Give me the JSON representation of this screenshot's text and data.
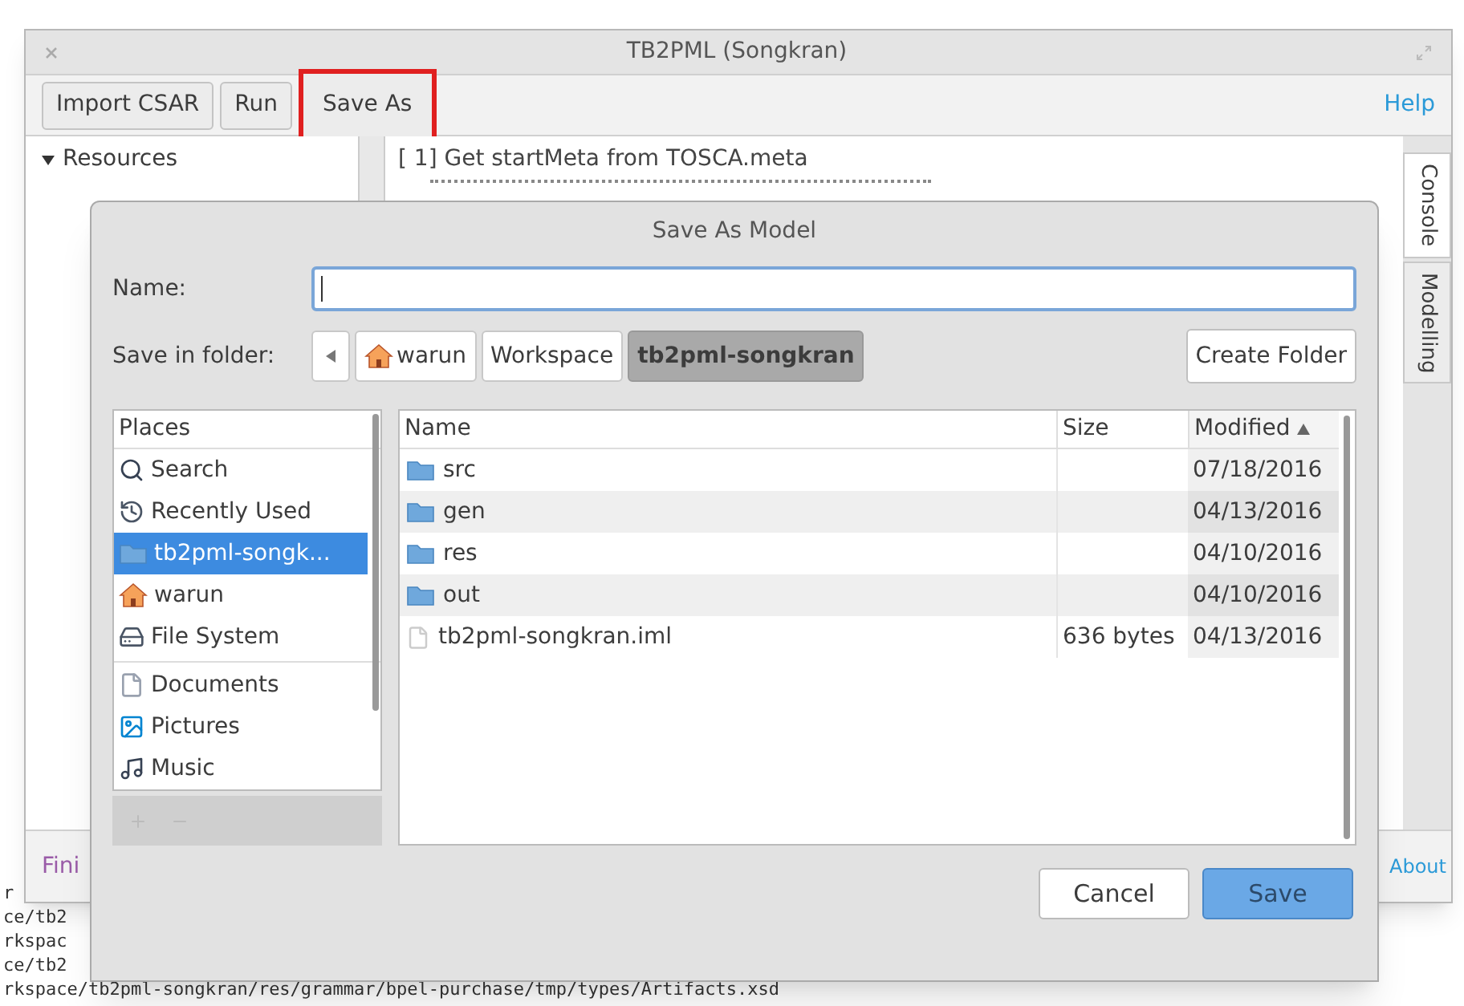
{
  "main_window": {
    "title": "TB2PML (Songkran)",
    "toolbar": [
      {
        "label": "Import CSAR",
        "highlighted": false
      },
      {
        "label": "Run",
        "highlighted": false
      },
      {
        "label": "Save As",
        "highlighted": true
      }
    ],
    "help_link": "Help",
    "tree": [
      {
        "label": "Resources",
        "expanded": true
      }
    ],
    "console_lines": [
      "[ 1] Get startMeta from TOSCA.meta"
    ],
    "side_tabs": [
      {
        "label": "Console",
        "selected": true
      },
      {
        "label": "Modelling",
        "selected": false
      }
    ],
    "status": "Fini",
    "about_link": "About"
  },
  "terminal_lines": [
    "r",
    "ce/tb2",
    "rkspac",
    "ce/tb2",
    "rkspace/tb2pml-songkran/res/grammar/bpel-purchase/tmp/types/Artifacts.xsd"
  ],
  "dialog": {
    "title": "Save As Model",
    "name_label": "Name:",
    "folder_label": "Save in folder:",
    "path": [
      {
        "label": "warun",
        "kind": "home",
        "selected": false
      },
      {
        "label": "Workspace",
        "kind": "folder",
        "selected": false
      },
      {
        "label": "tb2pml-songkran",
        "kind": "folder",
        "selected": true
      }
    ],
    "create_folder": "Create Folder",
    "places_header": "Places",
    "place_groups": [
      {
        "items": [
          {
            "label": "Search",
            "kind": "search",
            "selected": false
          },
          {
            "label": "Recently Used",
            "kind": "recent",
            "selected": false
          },
          {
            "label": "tb2pml-songk...",
            "kind": "folder",
            "selected": true
          },
          {
            "label": "warun",
            "kind": "home",
            "selected": false
          },
          {
            "label": "File System",
            "kind": "drive",
            "selected": false
          }
        ]
      },
      {
        "items": [
          {
            "label": "Documents",
            "kind": "document",
            "selected": false
          },
          {
            "label": "Pictures",
            "kind": "pictures",
            "selected": false
          },
          {
            "label": "Music",
            "kind": "music",
            "selected": false
          }
        ]
      }
    ],
    "columns": [
      {
        "label": "Name",
        "sorted": false
      },
      {
        "label": "Size",
        "sorted": false
      },
      {
        "label": "Modified",
        "sorted": true
      }
    ],
    "files": [
      {
        "name": "src",
        "kind": "folder",
        "modified": "07/18/2016"
      },
      {
        "name": "gen",
        "kind": "folder",
        "modified": "04/13/2016"
      },
      {
        "name": "res",
        "kind": "folder",
        "modified": "04/10/2016"
      },
      {
        "name": "out",
        "kind": "folder",
        "modified": "04/10/2016"
      },
      {
        "name": "tb2pml-songkran.iml",
        "kind": "file",
        "size": "636 bytes",
        "modified": "04/13/2016"
      }
    ],
    "buttons": [
      {
        "label": "Cancel",
        "kind": "secondary"
      },
      {
        "label": "Save",
        "kind": "primary"
      }
    ]
  }
}
